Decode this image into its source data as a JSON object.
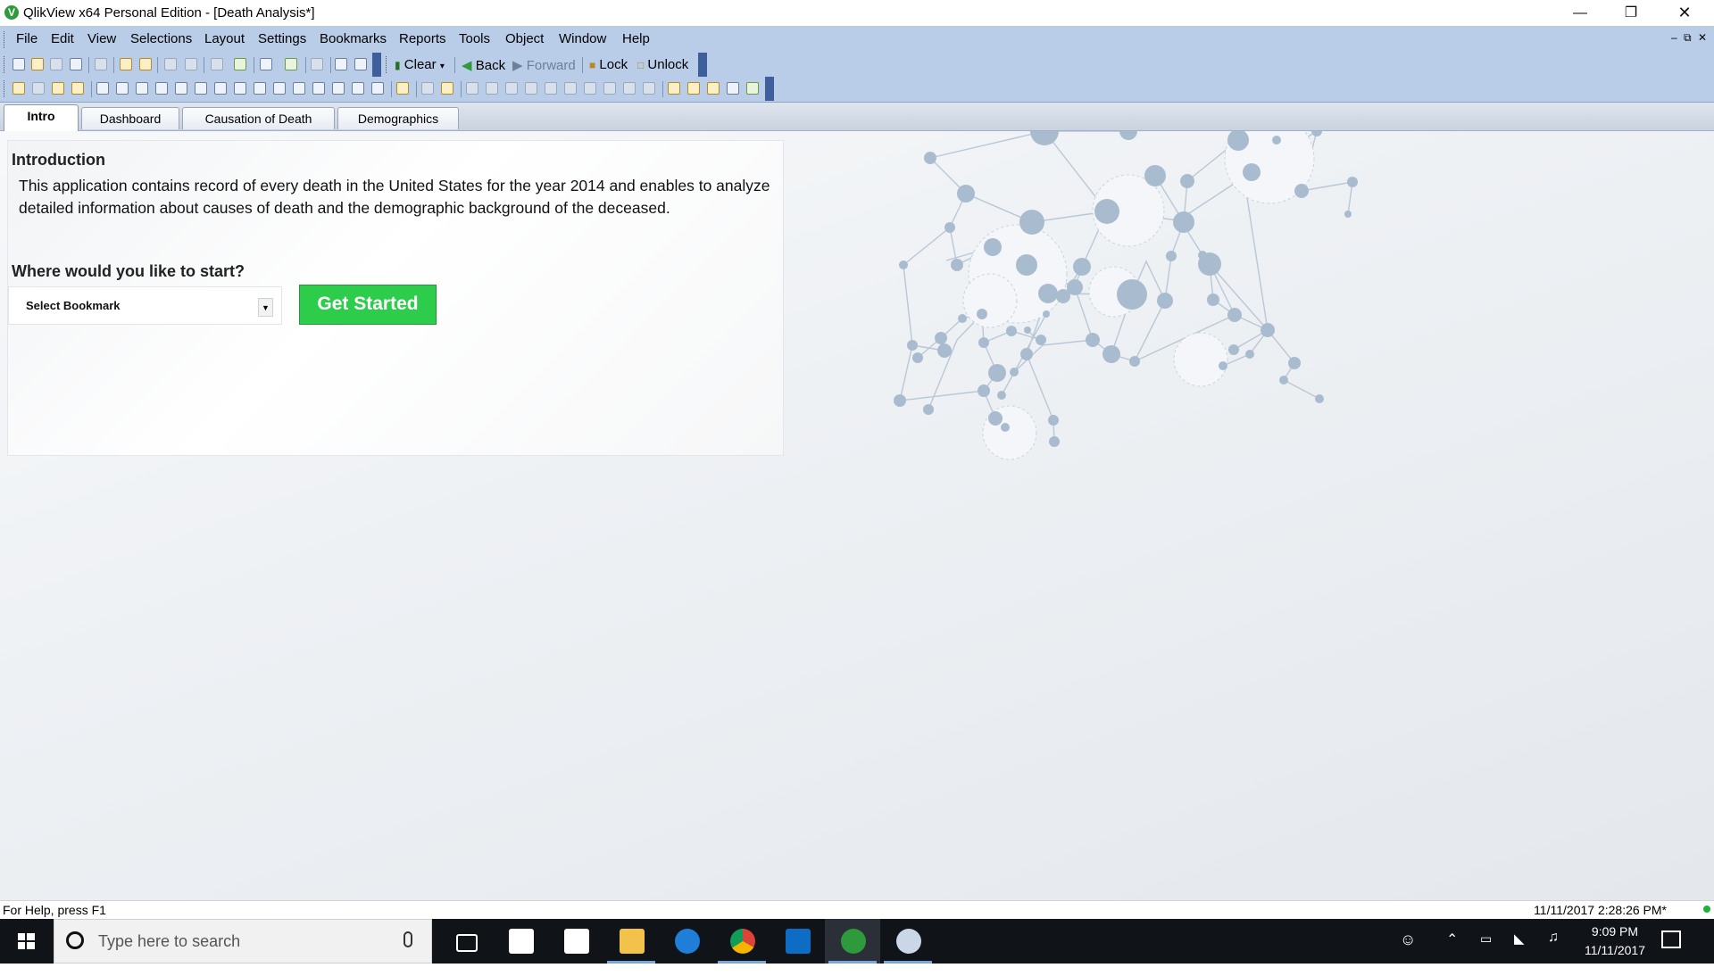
{
  "window": {
    "app_icon_letter": "V",
    "title": "QlikView x64 Personal Edition - [Death Analysis*]",
    "controls": [
      "minimize-icon",
      "restore-icon",
      "close-icon"
    ]
  },
  "menu": {
    "items": [
      "File",
      "Edit",
      "View",
      "Selections",
      "Layout",
      "Settings",
      "Bookmarks",
      "Reports",
      "Tools",
      "Object",
      "Window",
      "Help"
    ],
    "mdi_controls": [
      "‒",
      "⧉",
      "✕"
    ]
  },
  "toolbar": {
    "clear": "Clear",
    "back": "Back",
    "forward": "Forward",
    "lock": "Lock",
    "unlock": "Unlock"
  },
  "tabs": [
    {
      "label": "Intro",
      "active": true
    },
    {
      "label": "Dashboard",
      "active": false
    },
    {
      "label": "Causation of Death",
      "active": false
    },
    {
      "label": "Demographics",
      "active": false
    }
  ],
  "intro": {
    "heading": "Introduction",
    "text": "This application contains record of every death in the United States for the year 2014 and enables to analyze detailed information about causes of death and the demographic background of the deceased.",
    "start_heading": "Where would you like to start?",
    "bookmark_select": "Select Bookmark",
    "get_started": "Get Started"
  },
  "status": {
    "help": "For Help, press F1",
    "timestamp": "11/11/2017 2:28:26 PM*"
  },
  "taskbar": {
    "search_placeholder": "Type here to search",
    "apps": [
      "task-view-icon",
      "store-icon",
      "calendar-icon",
      "file-explorer-icon",
      "edge-icon",
      "chrome-icon",
      "outlook-icon",
      "qlikview-icon",
      "paint-icon"
    ],
    "time": "9:09 PM",
    "date": "11/11/2017"
  },
  "colors": {
    "menu_bg": "#b9cde9",
    "get_started_bg": "#2ecc4b",
    "taskbar_bg": "#101318",
    "network_node": "#a9bccf"
  }
}
